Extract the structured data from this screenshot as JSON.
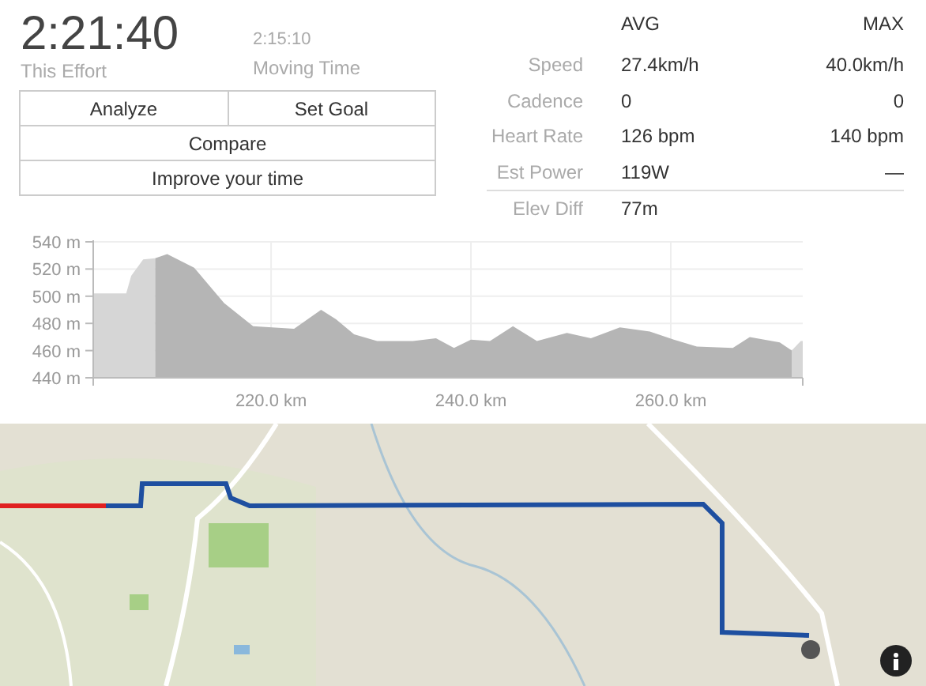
{
  "effort": {
    "time": "2:21:40",
    "label": "This Effort"
  },
  "moving": {
    "time": "2:15:10",
    "label": "Moving Time"
  },
  "button_rows": [
    [
      "Analyze",
      "Set Goal"
    ],
    [
      "Compare"
    ],
    [
      "Improve your time"
    ]
  ],
  "stats": {
    "columns": [
      "AVG",
      "MAX"
    ],
    "rows": [
      {
        "label": "Speed",
        "avg": "27.4km/h",
        "max": "40.0km/h"
      },
      {
        "label": "Cadence",
        "avg": "0",
        "max": "0"
      },
      {
        "label": "Heart Rate",
        "avg": "126 bpm",
        "max": "140 bpm"
      },
      {
        "label": "Est Power",
        "avg": "119W",
        "max": "—"
      }
    ],
    "footer_rows": [
      {
        "label": "Elev Diff",
        "avg": "77m"
      }
    ]
  },
  "elevation": {
    "chart_data": {
      "type": "area",
      "x": [
        202.2,
        205.5,
        206,
        207.2,
        208.4,
        209.6,
        212.3,
        215.3,
        218.2,
        222.3,
        225,
        226.5,
        228.3,
        230.6,
        234.2,
        236.5,
        238.3,
        240,
        241.9,
        244.2,
        246.6,
        249.6,
        252,
        254.9,
        257.9,
        260.3,
        262.6,
        266.2,
        267.9,
        270.9,
        272.1,
        273
      ],
      "series": [
        {
          "color": "#d6d6d6",
          "values": [
            502,
            502,
            515,
            527,
            528,
            null,
            null,
            null,
            null,
            null,
            null,
            null,
            null,
            null,
            null,
            null,
            null,
            null,
            null,
            null,
            null,
            null,
            null,
            null,
            null,
            null,
            null,
            null,
            null,
            null,
            460,
            467
          ]
        },
        {
          "color": "#b5b5b5",
          "values": [
            null,
            null,
            null,
            null,
            528,
            531,
            521,
            495,
            478,
            476,
            490,
            483,
            472,
            467,
            467,
            469,
            462,
            468,
            467,
            478,
            467,
            473,
            469,
            477,
            474,
            468,
            463,
            462,
            470,
            466,
            460,
            null
          ]
        }
      ],
      "xlim": [
        202.2,
        273.2
      ],
      "ylim": [
        440,
        540
      ],
      "grid": true,
      "xticks": [
        {
          "value": 220,
          "label": "220.0 km"
        },
        {
          "value": 240,
          "label": "240.0 km"
        },
        {
          "value": 260,
          "label": "260.0 km"
        }
      ],
      "yticks": [
        {
          "value": 440,
          "label": "440 m"
        },
        {
          "value": 460,
          "label": "460 m"
        },
        {
          "value": 480,
          "label": "480 m"
        },
        {
          "value": 500,
          "label": "500 m"
        },
        {
          "value": 520,
          "label": "520 m"
        },
        {
          "value": 540,
          "label": "540 m"
        }
      ]
    }
  },
  "map": {
    "kind": "picture"
  }
}
